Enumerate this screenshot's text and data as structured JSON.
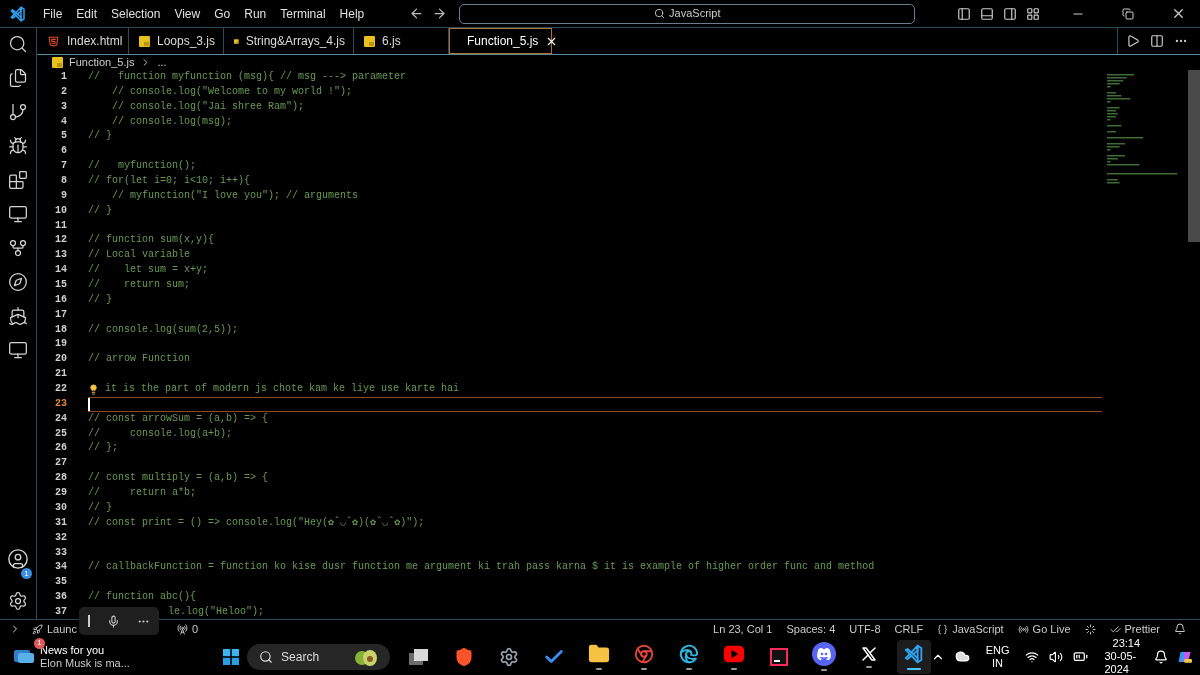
{
  "menu": [
    "File",
    "Edit",
    "Selection",
    "View",
    "Go",
    "Run",
    "Terminal",
    "Help"
  ],
  "command_center": {
    "value": "JavaScript"
  },
  "tabs": [
    {
      "label": "Index.html",
      "kind": "html",
      "selected": false
    },
    {
      "label": "Loops_3.js",
      "kind": "js",
      "selected": false
    },
    {
      "label": "String&Arrays_4.js",
      "kind": "js",
      "selected": false
    },
    {
      "label": "6.js",
      "kind": "js",
      "selected": false
    },
    {
      "label": "Function_5.js",
      "kind": "js",
      "selected": true
    }
  ],
  "breadcrumb": {
    "file": "Function_5.js",
    "rest": "..."
  },
  "account_badge": "1",
  "lines": [
    {
      "n": "1",
      "kind": "code",
      "text": "//   function myfunction (msg){ // msg ---> parameter",
      "current": false
    },
    {
      "n": "2",
      "kind": "code",
      "text": "    // console.log(\"Welcome to my world !\");",
      "current": false
    },
    {
      "n": "3",
      "kind": "code",
      "text": "    // console.log(\"Jai shree Ram\");",
      "current": false
    },
    {
      "n": "4",
      "kind": "code",
      "text": "    // console.log(msg);",
      "current": false
    },
    {
      "n": "5",
      "kind": "code",
      "text": "// }",
      "current": false
    },
    {
      "n": "6",
      "kind": "code",
      "current": false
    },
    {
      "n": "7",
      "kind": "code",
      "text": "//   myfunction();",
      "current": false
    },
    {
      "n": "8",
      "kind": "code",
      "text": "// for(let i=0; i<10; i++){",
      "current": false
    },
    {
      "n": "9",
      "kind": "code",
      "text": "    // myfunction(\"I love you\"); // arguments",
      "current": false
    },
    {
      "n": "10",
      "kind": "code",
      "text": "// }",
      "current": false
    },
    {
      "n": "11",
      "kind": "code",
      "current": false
    },
    {
      "n": "12",
      "kind": "code",
      "text": "// function sum(x,y){",
      "current": false
    },
    {
      "n": "13",
      "kind": "code",
      "text": "// Local variable",
      "current": false
    },
    {
      "n": "14",
      "kind": "code",
      "text": "//    let sum = x+y;",
      "current": false
    },
    {
      "n": "15",
      "kind": "code",
      "text": "//    return sum;",
      "current": false
    },
    {
      "n": "16",
      "kind": "code",
      "text": "// }",
      "current": false
    },
    {
      "n": "17",
      "kind": "code",
      "current": false
    },
    {
      "n": "18",
      "kind": "code",
      "text": "// console.log(sum(2,5));",
      "current": false
    },
    {
      "n": "19",
      "kind": "code",
      "current": false
    },
    {
      "n": "20",
      "kind": "code",
      "text": "// arrow Function",
      "current": false
    },
    {
      "n": "21",
      "kind": "code",
      "current": false
    },
    {
      "n": "22",
      "kind": "lightbulb",
      "text": "it is the part of modern js chote kam ke liye use karte hai",
      "current": false
    },
    {
      "n": "23",
      "kind": "code",
      "current": true
    },
    {
      "n": "24",
      "kind": "code",
      "text": "// const arrowSum = (a,b) => {",
      "current": false
    },
    {
      "n": "25",
      "kind": "code",
      "text": "//     console.log(a+b);",
      "current": false
    },
    {
      "n": "26",
      "kind": "code",
      "text": "// };",
      "current": false
    },
    {
      "n": "27",
      "kind": "code",
      "current": false
    },
    {
      "n": "28",
      "kind": "code",
      "text": "// const multiply = (a,b) => {",
      "current": false
    },
    {
      "n": "29",
      "kind": "code",
      "text": "//     return a*b;",
      "current": false
    },
    {
      "n": "30",
      "kind": "code",
      "text": "// }",
      "current": false
    },
    {
      "n": "31",
      "kind": "code",
      "text": "// const print = () => console.log(\"Hey(✿ˆ◡ˆ✿)(✿ˆ◡ˆ✿)\");",
      "current": false
    },
    {
      "n": "32",
      "kind": "code",
      "current": false
    },
    {
      "n": "33",
      "kind": "code",
      "current": false
    },
    {
      "n": "34",
      "kind": "code",
      "text": "// callbackFunction = function ko kise dusr function me argument ki trah pass karna $ it is example of higher order func and method",
      "current": false
    },
    {
      "n": "35",
      "kind": "code",
      "current": false
    },
    {
      "n": "36",
      "kind": "code",
      "text": "// function abc(){",
      "current": false
    },
    {
      "n": "37",
      "kind": "covered",
      "text": "le.log(\"Heloo\");",
      "current": false
    }
  ],
  "status_left": {
    "launch": "Launc",
    "ports": "0"
  },
  "status_right": [
    {
      "kind": "text",
      "label": "Ln 23, Col 1"
    },
    {
      "kind": "text",
      "label": "Spaces: 4"
    },
    {
      "kind": "text",
      "label": "UTF-8"
    },
    {
      "kind": "text",
      "label": "CRLF"
    },
    {
      "kind": "language",
      "label": "JavaScript"
    },
    {
      "kind": "golive",
      "label": "Go Live"
    },
    {
      "kind": "spinner"
    },
    {
      "kind": "prettier",
      "label": "Prettier"
    },
    {
      "kind": "bell"
    }
  ],
  "news": {
    "badge": "1",
    "title": "News for you",
    "subtitle": "Elon Musk is ma..."
  },
  "taskbar_search": {
    "placeholder": "Search"
  },
  "taskbar_apps": [
    {
      "kind": "taskview",
      "running": false
    },
    {
      "kind": "brave",
      "running": false
    },
    {
      "kind": "settings",
      "running": false
    },
    {
      "kind": "todo",
      "running": false
    },
    {
      "kind": "folder",
      "running": true
    },
    {
      "kind": "chrome",
      "running": true
    },
    {
      "kind": "edge",
      "running": true
    },
    {
      "kind": "youtube",
      "running": true
    },
    {
      "kind": "intellij",
      "running": false
    },
    {
      "kind": "discord",
      "running": true
    },
    {
      "kind": "x",
      "running": true
    },
    {
      "kind": "vscode",
      "running": true
    }
  ],
  "tray": {
    "lang": "ENG",
    "region": "IN",
    "time": "23:14",
    "date": "30-05-2024"
  }
}
